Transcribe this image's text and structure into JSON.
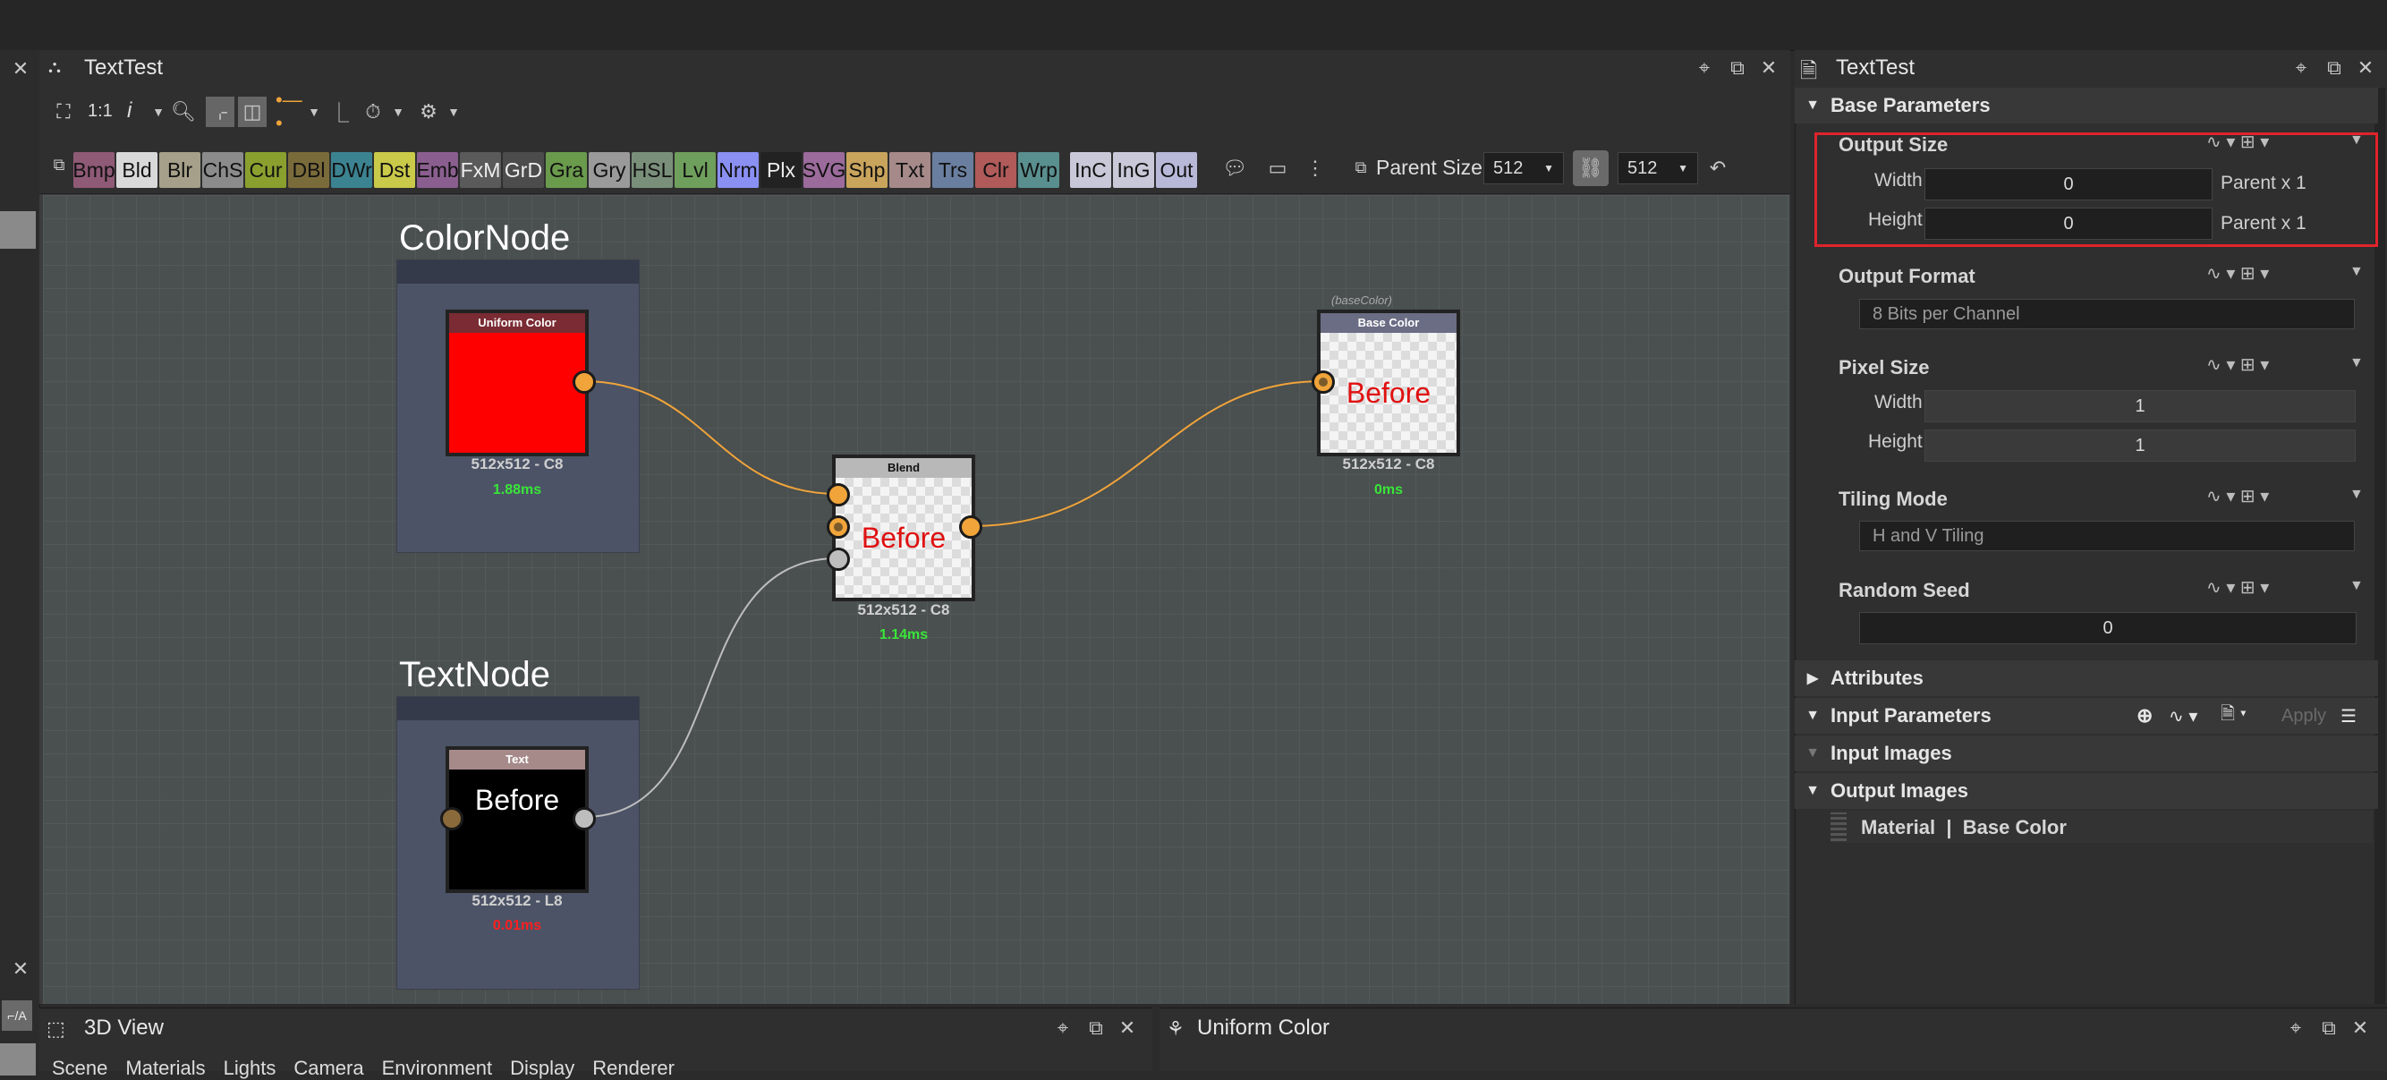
{
  "graph_panel": {
    "title": "TextTest",
    "toolbar": {
      "zoom_label": "1:1",
      "info_label": "i"
    },
    "node_chips": [
      {
        "label": "Bmp",
        "color": "#8f5a76"
      },
      {
        "label": "Bld",
        "color": "#d9d9d9"
      },
      {
        "label": "Blr",
        "color": "#a6a08a"
      },
      {
        "label": "ChS",
        "color": "#8b8b8b"
      },
      {
        "label": "Cur",
        "color": "#8aa02e"
      },
      {
        "label": "DBl",
        "color": "#7a6b3a"
      },
      {
        "label": "DWr",
        "color": "#3c8391"
      },
      {
        "label": "Dst",
        "color": "#c9c94a"
      },
      {
        "label": "Emb",
        "color": "#8a5f8f"
      },
      {
        "label": "FxM",
        "color": "#5a5a5a"
      },
      {
        "label": "GrD",
        "color": "#4c4c4c"
      },
      {
        "label": "Gra",
        "color": "#6a9a4c"
      },
      {
        "label": "Gry",
        "color": "#9a9a9a"
      },
      {
        "label": "HSL",
        "color": "#7a8f7a"
      },
      {
        "label": "Lvl",
        "color": "#6f9f5c"
      },
      {
        "label": "Nrm",
        "color": "#8a8ff2"
      },
      {
        "label": "Plx",
        "color": "#222222"
      },
      {
        "label": "SVG",
        "color": "#9b6b9b"
      },
      {
        "label": "Shp",
        "color": "#c9a45c"
      },
      {
        "label": "Txt",
        "color": "#a68a8a"
      },
      {
        "label": "Trs",
        "color": "#6a7fa0"
      },
      {
        "label": "Clr",
        "color": "#b05a5a"
      },
      {
        "label": "Wrp",
        "color": "#5a8f8f"
      },
      {
        "label": "InC",
        "color": "#c8c8d8"
      },
      {
        "label": "InG",
        "color": "#c8c8d8"
      },
      {
        "label": "Out",
        "color": "#b8b8d8"
      }
    ],
    "parent_size_label": "Parent Size:",
    "parent_size_value": "512",
    "size_value": "512"
  },
  "frames": {
    "color": {
      "title": "ColorNode"
    },
    "text": {
      "title": "TextNode"
    }
  },
  "nodes": {
    "uniform": {
      "title": "Uniform Color",
      "caption": "512x512 - C8",
      "time": "1.88ms",
      "title_color": "#7a2b33",
      "swatch": "#ff0000"
    },
    "blend": {
      "title": "Blend",
      "preview_text": "Before",
      "caption": "512x512 - C8",
      "time": "1.14ms"
    },
    "base": {
      "tag": "(baseColor)",
      "title": "Base Color",
      "preview_text": "Before",
      "caption": "512x512 - C8",
      "time": "0ms"
    },
    "text": {
      "title": "Text",
      "preview_text": "Before",
      "caption": "512x512 - L8",
      "time": "0.01ms"
    }
  },
  "properties": {
    "title": "TextTest",
    "base_parameters": "Base Parameters",
    "output_size": {
      "label": "Output Size",
      "width_label": "Width",
      "width_value": "0",
      "width_suffix": "Parent x 1",
      "height_label": "Height",
      "height_value": "0",
      "height_suffix": "Parent x 1"
    },
    "output_format": {
      "label": "Output Format",
      "value": "8 Bits per Channel"
    },
    "pixel_size": {
      "label": "Pixel Size",
      "width_label": "Width",
      "width_value": "1",
      "height_label": "Height",
      "height_value": "1"
    },
    "tiling_mode": {
      "label": "Tiling Mode",
      "value": "H and V Tiling"
    },
    "random_seed": {
      "label": "Random Seed",
      "value": "0"
    },
    "attributes": "Attributes",
    "input_parameters": "Input Parameters",
    "apply_label": "Apply",
    "input_images": "Input Images",
    "output_images": "Output Images",
    "output_item": "Material  |  Base Color"
  },
  "bottom": {
    "view3d_title": "3D View",
    "view3d_menu": [
      "Scene",
      "Materials",
      "Lights",
      "Camera",
      "Environment",
      "Display",
      "Renderer"
    ],
    "uniform_title": "Uniform Color"
  },
  "colors": {
    "highlight": "#e0242c",
    "wire_orange": "#f0a43a",
    "wire_gray": "#bdbdbd",
    "time_green": "#39e639",
    "time_red": "#ff2020"
  }
}
